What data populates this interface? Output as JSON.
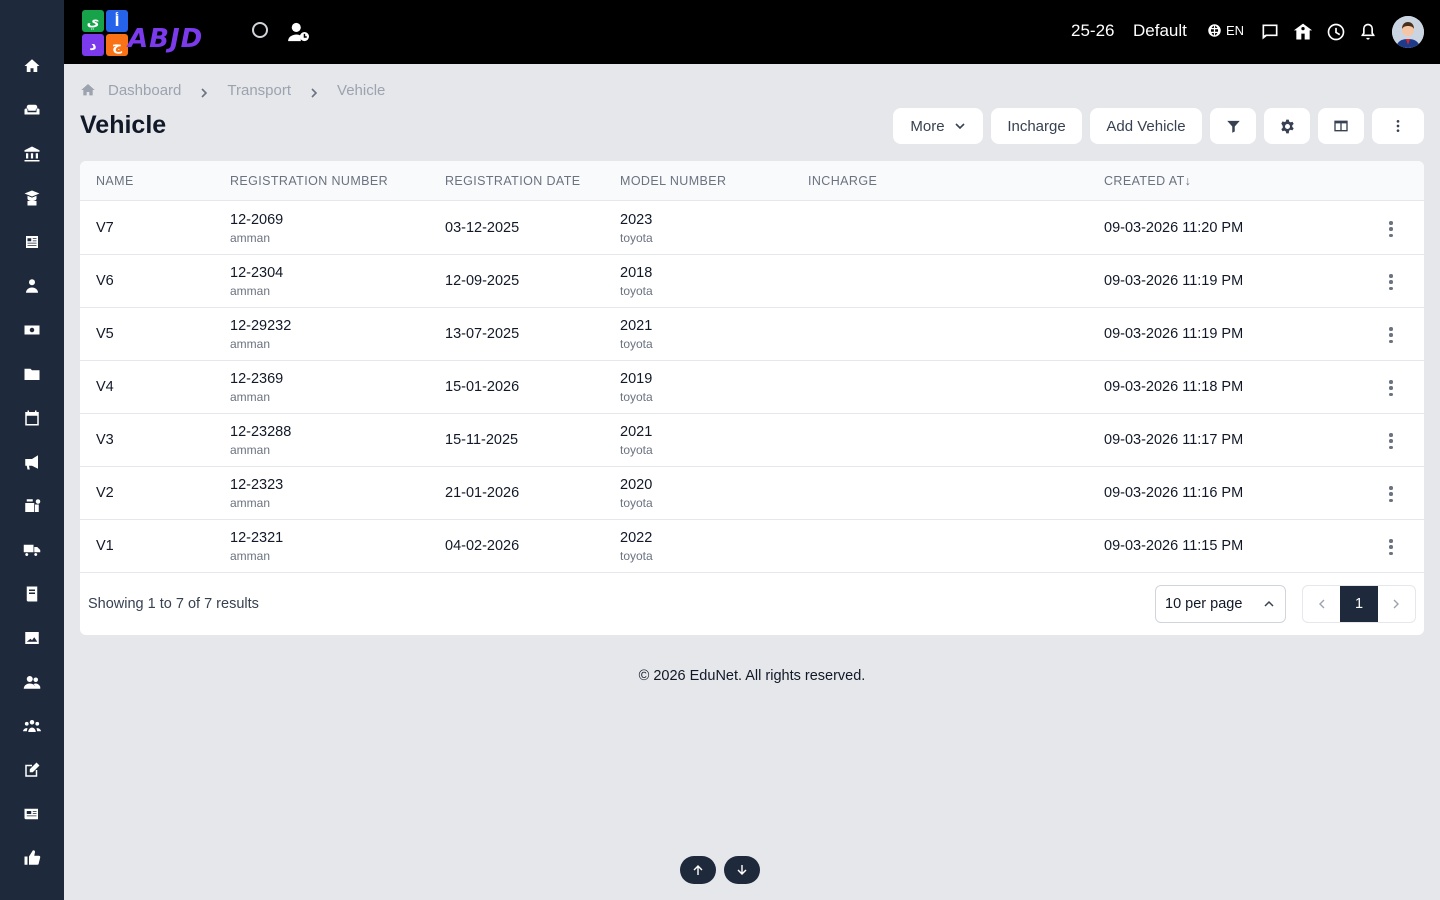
{
  "app": {
    "logo_text": "ABJD",
    "logo_letters": [
      "ي",
      "أ",
      "د",
      "ج"
    ],
    "colors": {
      "sidebar": "#1e293b",
      "topbar": "#000000",
      "accent": "#1e293b",
      "logo_tiles": [
        "#16a34a",
        "#2563eb",
        "#7c3aed",
        "#f97316"
      ]
    }
  },
  "topbar": {
    "session": "25-26",
    "profile": "Default",
    "language": "EN",
    "icons": [
      "globe-icon",
      "chat-icon",
      "school-icon",
      "clock-icon",
      "bell-icon"
    ]
  },
  "sidebar": {
    "icons": [
      "home-icon",
      "sofa-icon",
      "bank-icon",
      "graduate-icon",
      "news-icon",
      "teacher-icon",
      "money-icon",
      "folder-icon",
      "calendar-icon",
      "megaphone-icon",
      "cash-register-icon",
      "truck-icon",
      "book-icon",
      "image-icon",
      "users-icon",
      "group-icon",
      "edit-icon",
      "newspaper-icon",
      "thumbs-up-icon"
    ]
  },
  "breadcrumb": [
    "Dashboard",
    "Transport",
    "Vehicle"
  ],
  "page": {
    "title": "Vehicle"
  },
  "toolbar": {
    "more_label": "More",
    "incharge_label": "Incharge",
    "add_label": "Add Vehicle"
  },
  "table": {
    "columns": [
      "NAME",
      "REGISTRATION NUMBER",
      "REGISTRATION DATE",
      "MODEL NUMBER",
      "INCHARGE",
      "CREATED AT"
    ],
    "sort_indicator": "↓",
    "rows": [
      {
        "name": "V7",
        "reg_no": "12-2069",
        "reg_sub": "amman",
        "reg_date": "03-12-2025",
        "model": "2023",
        "model_sub": "toyota",
        "incharge": "",
        "created": "09-03-2026 11:20 PM"
      },
      {
        "name": "V6",
        "reg_no": "12-2304",
        "reg_sub": "amman",
        "reg_date": "12-09-2025",
        "model": "2018",
        "model_sub": "toyota",
        "incharge": "",
        "created": "09-03-2026 11:19 PM"
      },
      {
        "name": "V5",
        "reg_no": "12-29232",
        "reg_sub": "amman",
        "reg_date": "13-07-2025",
        "model": "2021",
        "model_sub": "toyota",
        "incharge": "",
        "created": "09-03-2026 11:19 PM"
      },
      {
        "name": "V4",
        "reg_no": "12-2369",
        "reg_sub": "amman",
        "reg_date": "15-01-2026",
        "model": "2019",
        "model_sub": "toyota",
        "incharge": "",
        "created": "09-03-2026 11:18 PM"
      },
      {
        "name": "V3",
        "reg_no": "12-23288",
        "reg_sub": "amman",
        "reg_date": "15-11-2025",
        "model": "2021",
        "model_sub": "toyota",
        "incharge": "",
        "created": "09-03-2026 11:17 PM"
      },
      {
        "name": "V2",
        "reg_no": "12-2323",
        "reg_sub": "amman",
        "reg_date": "21-01-2026",
        "model": "2020",
        "model_sub": "toyota",
        "incharge": "",
        "created": "09-03-2026 11:16 PM"
      },
      {
        "name": "V1",
        "reg_no": "12-2321",
        "reg_sub": "amman",
        "reg_date": "04-02-2026",
        "model": "2022",
        "model_sub": "toyota",
        "incharge": "",
        "created": "09-03-2026 11:15 PM"
      }
    ]
  },
  "pagination": {
    "info": "Showing 1 to 7 of 7 results",
    "per_page": "10 per page",
    "current_page": "1"
  },
  "footer": {
    "copyright": "© 2026 EduNet. All rights reserved."
  }
}
